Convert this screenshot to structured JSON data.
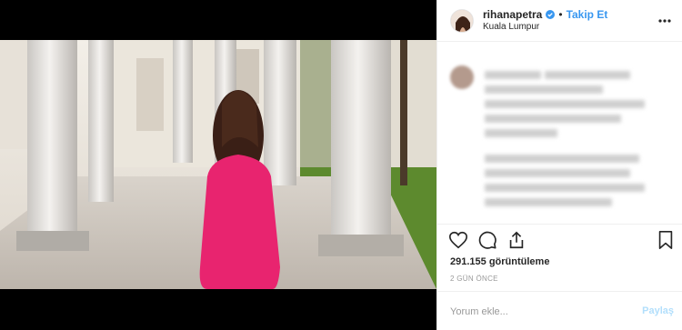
{
  "header": {
    "username": "rihanapetra",
    "separator": "•",
    "follow_label": "Takip Et",
    "location": "Kuala Lumpur"
  },
  "actions": {
    "views": "291.155 görüntüleme",
    "time": "2 GÜN ÖNCE"
  },
  "comment": {
    "placeholder": "Yorum ekle...",
    "submit_label": "Paylaş"
  },
  "icons": {
    "verified": "verified-badge-icon",
    "more": "more-options-icon",
    "like": "heart-icon",
    "comment": "comment-icon",
    "share": "share-icon",
    "save": "bookmark-icon"
  },
  "colors": {
    "accent": "#3897f0",
    "dress": "#e8246f"
  }
}
